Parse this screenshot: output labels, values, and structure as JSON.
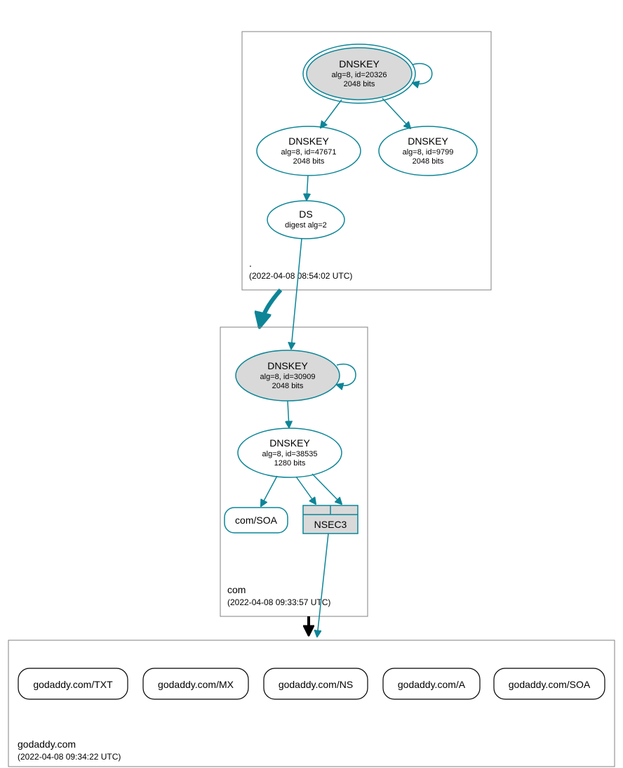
{
  "zones": {
    "root": {
      "label": ".",
      "ts": "(2022-04-08 08:54:02 UTC)"
    },
    "com": {
      "label": "com",
      "ts": "(2022-04-08 09:33:57 UTC)"
    },
    "godaddy": {
      "label": "godaddy.com",
      "ts": "(2022-04-08 09:34:22 UTC)"
    }
  },
  "nodes": {
    "root_ksk": {
      "title": "DNSKEY",
      "l2": "alg=8, id=20326",
      "l3": "2048 bits"
    },
    "root_zsk1": {
      "title": "DNSKEY",
      "l2": "alg=8, id=47671",
      "l3": "2048 bits"
    },
    "root_zsk2": {
      "title": "DNSKEY",
      "l2": "alg=8, id=9799",
      "l3": "2048 bits"
    },
    "root_ds": {
      "title": "DS",
      "l2": "digest alg=2"
    },
    "com_ksk": {
      "title": "DNSKEY",
      "l2": "alg=8, id=30909",
      "l3": "2048 bits"
    },
    "com_zsk": {
      "title": "DNSKEY",
      "l2": "alg=8, id=38535",
      "l3": "1280 bits"
    },
    "com_soa": {
      "title": "com/SOA"
    },
    "nsec3": {
      "title": "NSEC3"
    },
    "gd_txt": {
      "title": "godaddy.com/TXT"
    },
    "gd_mx": {
      "title": "godaddy.com/MX"
    },
    "gd_ns": {
      "title": "godaddy.com/NS"
    },
    "gd_a": {
      "title": "godaddy.com/A"
    },
    "gd_soa": {
      "title": "godaddy.com/SOA"
    }
  }
}
